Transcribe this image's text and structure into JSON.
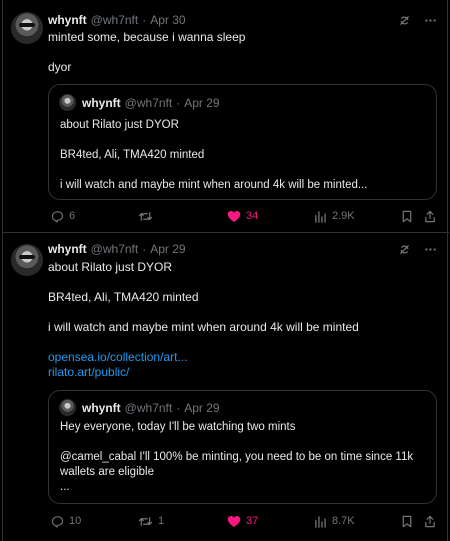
{
  "posts": [
    {
      "name": "whynft",
      "handle": "@wh7nft",
      "date": "Apr 30",
      "lines": [
        "minted some, because i wanna sleep",
        "dyor"
      ],
      "quote": {
        "name": "whynft",
        "handle": "@wh7nft",
        "date": "Apr 29",
        "lines": [
          "about Rilato just DYOR",
          "BR4ted, Ali, TMA420 minted",
          "i will watch and maybe mint when around 4k will be minted..."
        ]
      },
      "stats": {
        "replies": "6",
        "reposts": "",
        "likes": "34",
        "views": "2.9K"
      }
    },
    {
      "name": "whynft",
      "handle": "@wh7nft",
      "date": "Apr 29",
      "lines": [
        "about Rilato just DYOR",
        "BR4ted, Ali, TMA420 minted",
        "i will watch and maybe mint when around 4k will be minted"
      ],
      "links": [
        "opensea.io/collection/art...",
        "rilato.art/public/"
      ],
      "quote": {
        "name": "whynft",
        "handle": "@wh7nft",
        "date": "Apr 29",
        "lines": [
          "Hey everyone, today I'll be watching two mints",
          "@camel_cabal   I'll 100% be minting, you need to be on time since 11k",
          "wallets are eligible",
          "..."
        ]
      },
      "stats": {
        "replies": "10",
        "reposts": "1",
        "likes": "37",
        "views": "8.7K"
      }
    }
  ],
  "icons": {
    "grok": "grok-icon",
    "more": "more-icon",
    "reply": "reply-icon",
    "repost": "repost-icon",
    "like": "heart-icon",
    "views": "views-icon",
    "bookmark": "bookmark-icon",
    "share": "share-icon"
  },
  "colors": {
    "background": "#000000",
    "text": "#e7e9ea",
    "muted": "#71767b",
    "link": "#1d9bf0",
    "like": "#f91880",
    "border": "#2f3336"
  }
}
